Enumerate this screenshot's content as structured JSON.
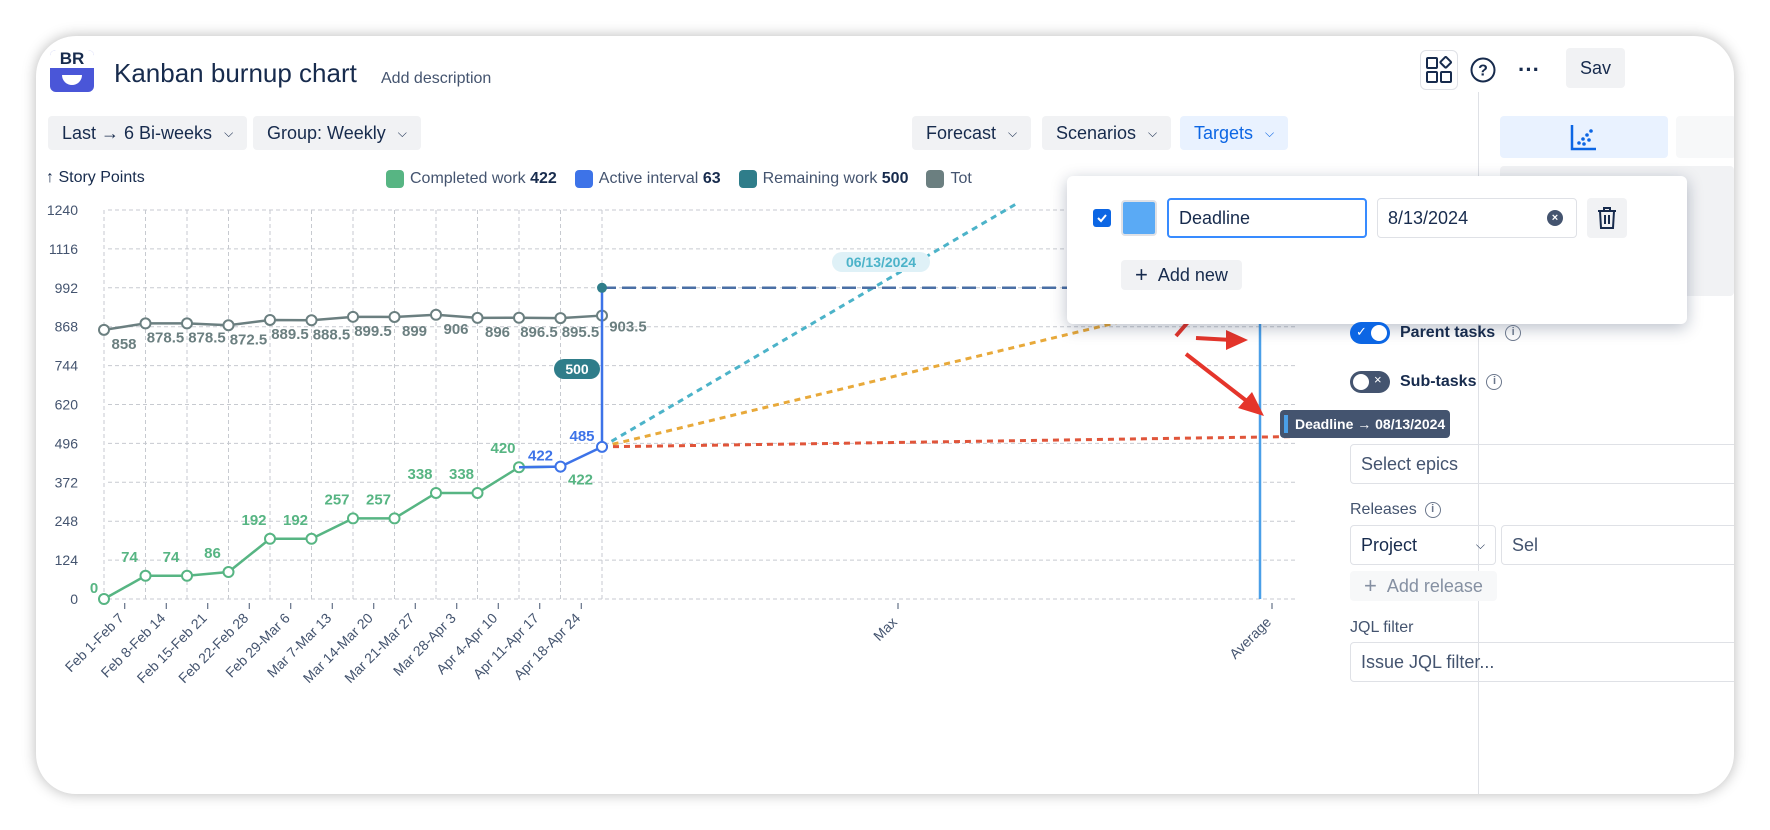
{
  "header": {
    "logo_text": "BR",
    "title": "Kanban burnup chart",
    "add_description": "Add description",
    "save_label": "Sav"
  },
  "toolbar": {
    "range_label": "Last → 6 Bi-weeks",
    "group_label": "Group: Weekly",
    "forecast_label": "Forecast",
    "scenarios_label": "Scenarios",
    "targets_label": "Targets"
  },
  "legend": {
    "y_axis_title": "↑ Story Points",
    "items": [
      {
        "label": "Completed work",
        "value": "422",
        "color": "#57b583"
      },
      {
        "label": "Active interval",
        "value": "63",
        "color": "#3d73e8"
      },
      {
        "label": "Remaining work",
        "value": "500",
        "color": "#2f7d8a"
      },
      {
        "label": "Tot",
        "value": "",
        "color": "#6b7f80"
      }
    ]
  },
  "targets_popup": {
    "name_value": "Deadline",
    "date_value": "8/13/2024",
    "add_new_label": "Add new",
    "swatch_color": "#5aaaf5"
  },
  "sidebar": {
    "parent_tasks_label": "Parent tasks",
    "sub_tasks_label": "Sub-tasks",
    "select_epics_placeholder": "Select epics",
    "releases_label": "Releases",
    "project_select_value": "Project",
    "second_select_value": "Sel",
    "add_release_label": "Add release",
    "jql_label": "JQL filter",
    "jql_placeholder": "Issue JQL filter..."
  },
  "chart_data": {
    "type": "line",
    "y_ticks": [
      "1240",
      "1116",
      "992",
      "868",
      "744",
      "620",
      "496",
      "372",
      "248",
      "124",
      "0"
    ],
    "ylim": [
      0,
      1240
    ],
    "categories": [
      "Feb 1-Feb 7",
      "Feb 8-Feb 14",
      "Feb 15-Feb 21",
      "Feb 22-Feb 28",
      "Feb 29-Mar 6",
      "Mar 7-Mar 13",
      "Mar 14-Mar 20",
      "Mar 21-Mar 27",
      "Mar 28-Apr 3",
      "Apr 4-Apr 10",
      "Apr 11-Apr 17",
      "Apr 18-Apr 24"
    ],
    "extra_x_labels": [
      "Max",
      "Average"
    ],
    "series": [
      {
        "name": "Total scope",
        "color": "#6b7f80",
        "values": [
          858,
          878.5,
          878.5,
          872.5,
          889.5,
          888.5,
          899.5,
          899,
          906,
          896,
          896.5,
          895.5
        ],
        "end_value": 903.5,
        "labels": [
          "858",
          "878.5",
          "878.5",
          "872.5",
          "889.5",
          "888.5",
          "899.5",
          "899",
          "906",
          "896",
          "896.5",
          "895.5",
          "903.5"
        ]
      },
      {
        "name": "Completed work",
        "color": "#57b583",
        "values": [
          0,
          74,
          74,
          86,
          192,
          192,
          257,
          257,
          338,
          338,
          420,
          422
        ],
        "labels": [
          "0",
          "74",
          "74",
          "86",
          "192",
          "192",
          "257",
          "257",
          "338",
          "338",
          "420",
          "422"
        ]
      },
      {
        "name": "Active interval",
        "color": "#3d73e8",
        "values": [
          420,
          422,
          485
        ],
        "labels": [
          "422",
          "485"
        ]
      }
    ],
    "remaining_badge": "500",
    "scope_target": 992,
    "forecast_date_label": "06/13/2024",
    "deadline_label": "Deadline → 08/13/2024",
    "forecast_colors": {
      "optimistic": "#4cb3c9",
      "average": "#e8a93a",
      "pessimistic": "#e0553a",
      "deadline": "#4a9fe8"
    }
  }
}
